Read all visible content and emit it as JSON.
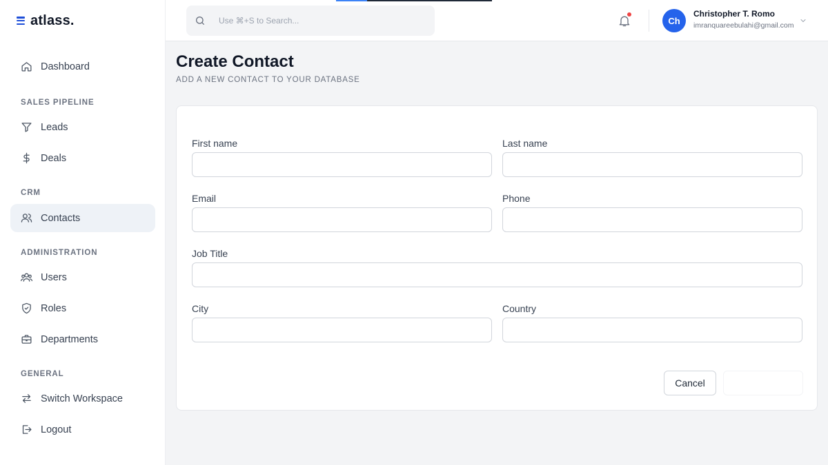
{
  "app": {
    "logo_text": "atlass."
  },
  "colors": {
    "brand": "#1d4ed8",
    "avatar_bg": "#2563eb",
    "notification_dot": "#ef4444",
    "active_nav_bg": "#eef2f7"
  },
  "sidebar": {
    "items": [
      {
        "label": "Dashboard",
        "icon": "home-icon"
      },
      {
        "label": "Leads",
        "icon": "filter-icon"
      },
      {
        "label": "Deals",
        "icon": "dollar-icon"
      },
      {
        "label": "Contacts",
        "icon": "contacts-icon",
        "active": true
      },
      {
        "label": "Users",
        "icon": "users-icon"
      },
      {
        "label": "Roles",
        "icon": "shield-icon"
      },
      {
        "label": "Departments",
        "icon": "briefcase-icon"
      },
      {
        "label": "Switch Workspace",
        "icon": "switch-icon"
      },
      {
        "label": "Logout",
        "icon": "logout-icon"
      }
    ],
    "sections": [
      "SALES PIPELINE",
      "CRM",
      "ADMINISTRATION",
      "GENERAL"
    ]
  },
  "header": {
    "search_placeholder": "Use ⌘+S to Search...",
    "user": {
      "initials": "Ch",
      "name": "Christopher T. Romo",
      "email": "imranquareebulahi@gmail.com"
    }
  },
  "page": {
    "title": "Create Contact",
    "subtitle": "ADD A NEW CONTACT TO YOUR DATABASE"
  },
  "form": {
    "fields": {
      "first_name": {
        "label": "First name",
        "value": ""
      },
      "last_name": {
        "label": "Last name",
        "value": ""
      },
      "email": {
        "label": "Email",
        "value": ""
      },
      "phone": {
        "label": "Phone",
        "value": ""
      },
      "job_title": {
        "label": "Job Title",
        "value": ""
      },
      "city": {
        "label": "City",
        "value": ""
      },
      "country": {
        "label": "Country",
        "value": ""
      }
    },
    "cancel_label": "Cancel"
  }
}
